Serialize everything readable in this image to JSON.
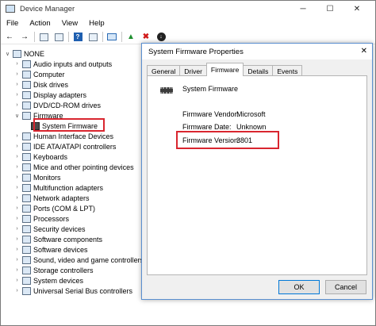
{
  "window": {
    "title": "Device Manager",
    "minimize": "─",
    "maximize": "☐",
    "close": "✕"
  },
  "menu": [
    "File",
    "Action",
    "View",
    "Help"
  ],
  "tree": {
    "root": "NONE",
    "items": [
      {
        "label": "Audio inputs and outputs",
        "expanded": false
      },
      {
        "label": "Computer",
        "expanded": false
      },
      {
        "label": "Disk drives",
        "expanded": false
      },
      {
        "label": "Display adapters",
        "expanded": false
      },
      {
        "label": "DVD/CD-ROM drives",
        "expanded": false
      },
      {
        "label": "Firmware",
        "expanded": true
      },
      {
        "label": "System Firmware",
        "child": true,
        "selected": true
      },
      {
        "label": "Human Interface Devices",
        "expanded": false
      },
      {
        "label": "IDE ATA/ATAPI controllers",
        "expanded": false
      },
      {
        "label": "Keyboards",
        "expanded": false
      },
      {
        "label": "Mice and other pointing devices",
        "expanded": false
      },
      {
        "label": "Monitors",
        "expanded": false
      },
      {
        "label": "Multifunction adapters",
        "expanded": false
      },
      {
        "label": "Network adapters",
        "expanded": false
      },
      {
        "label": "Ports (COM & LPT)",
        "expanded": false
      },
      {
        "label": "Processors",
        "expanded": false
      },
      {
        "label": "Security devices",
        "expanded": false
      },
      {
        "label": "Software components",
        "expanded": false
      },
      {
        "label": "Software devices",
        "expanded": false
      },
      {
        "label": "Sound, video and game controllers",
        "expanded": false
      },
      {
        "label": "Storage controllers",
        "expanded": false
      },
      {
        "label": "System devices",
        "expanded": false
      },
      {
        "label": "Universal Serial Bus controllers",
        "expanded": false
      }
    ]
  },
  "dialog": {
    "title": "System Firmware Properties",
    "close": "✕",
    "tabs": [
      "General",
      "Driver",
      "Firmware",
      "Details",
      "Events"
    ],
    "active_tab": "Firmware",
    "device_name": "System Firmware",
    "fields": [
      {
        "label": "Firmware Vendor:",
        "value": "Microsoft"
      },
      {
        "label": "Firmware Date:",
        "value": "Unknown"
      },
      {
        "label": "Firmware Version:",
        "value": "3801"
      }
    ],
    "ok_label": "OK",
    "cancel_label": "Cancel"
  },
  "colors": {
    "highlight": "#d9262f",
    "dialog_border": "#5a8fd0"
  }
}
